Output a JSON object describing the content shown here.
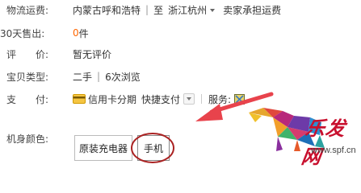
{
  "shipping": {
    "label": "物流运费:",
    "from": "内蒙古呼和浩特",
    "sep": "|",
    "to_prefix": "至",
    "to": "浙江杭州",
    "note": "卖家承担运费"
  },
  "sales": {
    "label": "30天售出:",
    "count": "0",
    "unit": "件"
  },
  "rating": {
    "label": "评　　价:",
    "value": "暂无评价"
  },
  "item_type": {
    "label": "宝贝类型:",
    "condition": "二手",
    "sep": "|",
    "views": "6次浏览"
  },
  "payment": {
    "label": "支　　付:",
    "credit": "信用卡分期",
    "quick": "快捷支付",
    "service_label": "服务:"
  },
  "body_color": {
    "label": "机身颜色:",
    "options": [
      "原装充电器",
      "手机"
    ]
  },
  "watermark": {
    "brand": "乐发网",
    "url": "www.spf.cn"
  },
  "colors": {
    "accent": "#f60",
    "arrow": "#e8434c",
    "circle": "#a22",
    "brand_red": "#c8102e"
  }
}
